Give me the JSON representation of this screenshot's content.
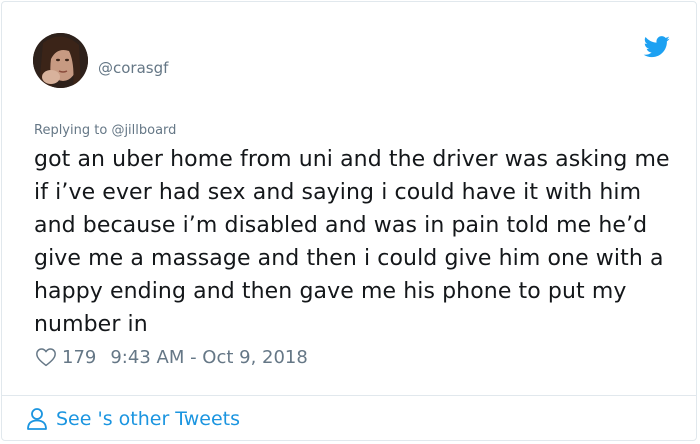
{
  "tweet": {
    "handle": "@corasgf",
    "reply_prefix": "Replying to ",
    "reply_to": "@jillboard",
    "text": "got an uber home from uni and the driver was asking me if i’ve ever had sex and saying i could have it with him and because i’m disabled and was in pain told me he’d give me a massage and then i could give him one with a happy ending and then gave me his phone to put my number in",
    "likes": "179",
    "timestamp": "9:43 AM - Oct 9, 2018"
  },
  "footer": {
    "label": "See 's other Tweets"
  },
  "icons": {
    "brand": "twitter-bird-icon",
    "like": "heart-icon",
    "footer": "person-icon"
  },
  "colors": {
    "accent": "#1da1f2",
    "link": "#1b95e0",
    "muted": "#657786",
    "text": "#14171a",
    "border": "#e1e8ed"
  }
}
